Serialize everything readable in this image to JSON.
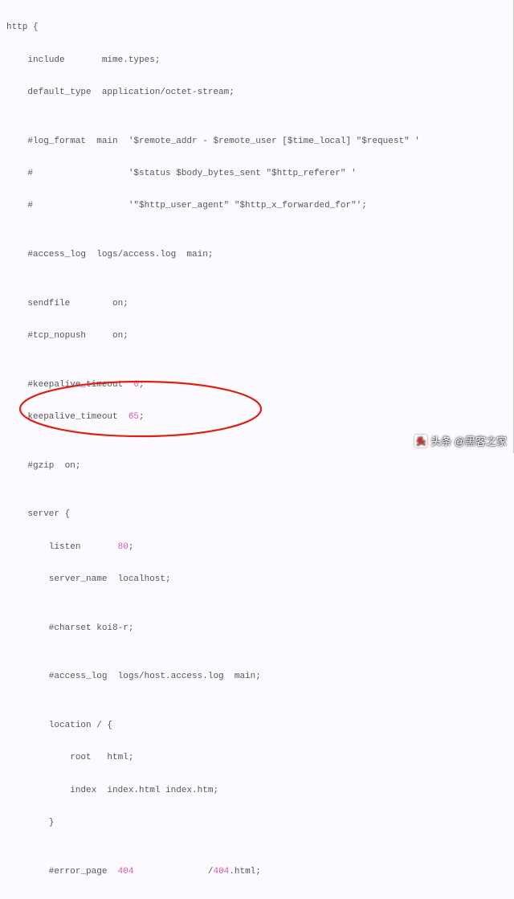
{
  "code": {
    "l1": "http {",
    "l2": "    include       mime.types;",
    "l3": "    default_type  application/octet-stream;",
    "l4": "",
    "l5_a": "    #log_format  main  '$remote_addr - $remote_user [$time_local] \"$request\" '",
    "l6_a": "    #                  '$status $body_bytes_sent \"$http_referer\" '",
    "l7_a": "    #                  '\"$http_user_agent\" \"$http_x_forwarded_for\"';",
    "l8": "",
    "l9": "    #access_log  logs/access.log  main;",
    "l10": "",
    "l11": "    sendfile        on;",
    "l12": "    #tcp_nopush     on;",
    "l13": "",
    "l14_a": "    #keepalive_timeout  ",
    "l14_b": "0",
    "l14_c": ";",
    "l15_a": "    keepalive_timeout  ",
    "l15_b": "65",
    "l15_c": ";",
    "l16": "",
    "l17": "    #gzip  on;",
    "l18": "",
    "l19": "    server {",
    "l20_a": "        listen       ",
    "l20_b": "80",
    "l20_c": ";",
    "l21": "        server_name  localhost;",
    "l22": "",
    "l23": "        #charset koi8-r;",
    "l24": "",
    "l25": "        #access_log  logs/host.access.log  main;",
    "l26": "",
    "l27": "        location / {",
    "l28": "            root   html;",
    "l29": "            index  index.html index.htm;",
    "l30": "        }",
    "l31": "",
    "l32_a": "        #error_page  ",
    "l32_b": "404",
    "l32_c": "              /",
    "l32_d": "404",
    "l32_e": ".html;"
  },
  "watermark": {
    "icon_glyph": "头",
    "text": "头条 @黑客之家"
  }
}
